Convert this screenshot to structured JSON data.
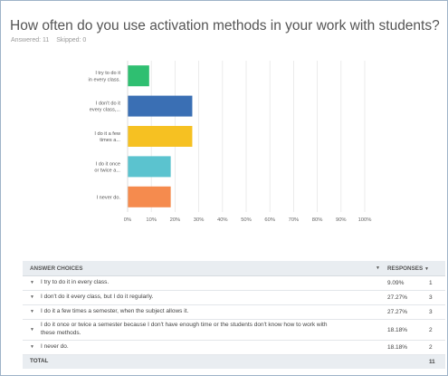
{
  "question": {
    "title": "How often do you use activation methods in your work with students?",
    "answered": "Answered: 11",
    "skipped": "Skipped: 0"
  },
  "chart_data": {
    "type": "bar",
    "orientation": "horizontal",
    "categories": [
      [
        "I try to do it",
        "in every class."
      ],
      [
        "I don't do it",
        "every class,..."
      ],
      [
        "I do it a few",
        "times a..."
      ],
      [
        "I do it once",
        "or twice a..."
      ],
      [
        "I never do."
      ]
    ],
    "values": [
      9.09,
      27.27,
      27.27,
      18.18,
      18.18
    ],
    "colors": [
      "#2fbf71",
      "#3a6fb4",
      "#f6c122",
      "#5bc3cf",
      "#f58b4e"
    ],
    "xticks": [
      "0%",
      "10%",
      "20%",
      "30%",
      "40%",
      "50%",
      "60%",
      "70%",
      "80%",
      "90%",
      "100%"
    ],
    "xlim": [
      0,
      100
    ],
    "grid": true
  },
  "table": {
    "headers": {
      "choices": "ANSWER CHOICES",
      "responses": "RESPONSES"
    },
    "rows": [
      {
        "choice": "I try to do it in every class.",
        "percent": "9.09%",
        "count": "1"
      },
      {
        "choice": "I don't do it every class, but I do it regularly.",
        "percent": "27.27%",
        "count": "3"
      },
      {
        "choice": "I do it a few times a semester, when the subject allows it.",
        "percent": "27.27%",
        "count": "3"
      },
      {
        "choice": "I do it once or twice a semester because I don't have enough time or the students don't know how to work with these methods.",
        "percent": "18.18%",
        "count": "2"
      },
      {
        "choice": "I never do.",
        "percent": "18.18%",
        "count": "2"
      }
    ],
    "total_label": "TOTAL",
    "total_count": "11"
  }
}
